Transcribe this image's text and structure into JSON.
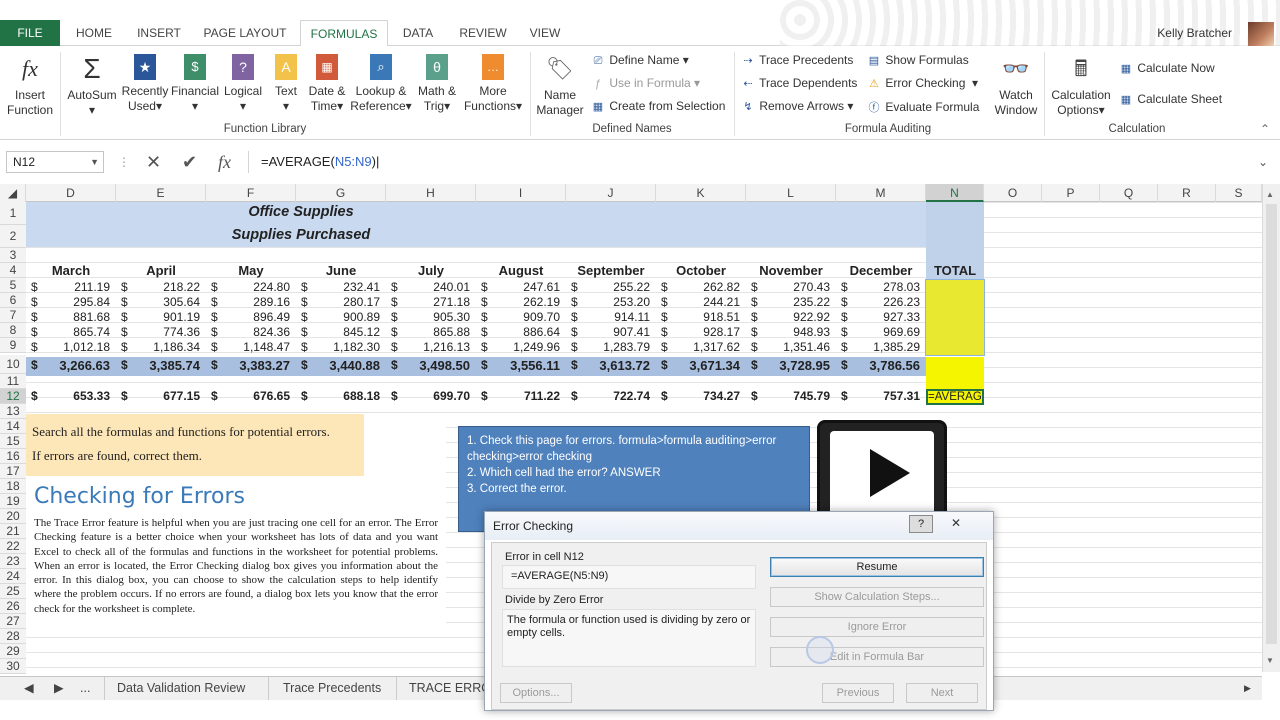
{
  "tabs": {
    "file": "FILE",
    "home": "HOME",
    "insert": "INSERT",
    "page_layout": "PAGE LAYOUT",
    "formulas": "FORMULAS",
    "data": "DATA",
    "review": "REVIEW",
    "view": "VIEW"
  },
  "user": "Kelly Bratcher",
  "ribbon": {
    "insert_function": [
      "Insert",
      "Function"
    ],
    "autosum": "AutoSum",
    "recently": [
      "Recently",
      "Used"
    ],
    "financial": "Financial",
    "logical": "Logical",
    "text": "Text",
    "date_time": [
      "Date &",
      "Time"
    ],
    "lookup": [
      "Lookup &",
      "Reference"
    ],
    "math": [
      "Math &",
      "Trig"
    ],
    "more": [
      "More",
      "Functions"
    ],
    "function_library": "Function Library",
    "name_manager": [
      "Name",
      "Manager"
    ],
    "define_name": "Define Name",
    "use_in_formula": "Use in Formula",
    "create_from_selection": "Create from Selection",
    "defined_names": "Defined Names",
    "trace_precedents": "Trace Precedents",
    "trace_dependents": "Trace Dependents",
    "remove_arrows": "Remove Arrows",
    "show_formulas": "Show Formulas",
    "error_checking": "Error Checking",
    "evaluate_formula": "Evaluate Formula",
    "formula_auditing": "Formula Auditing",
    "watch_window": [
      "Watch",
      "Window"
    ],
    "calc_options": [
      "Calculation",
      "Options"
    ],
    "calc_now": "Calculate Now",
    "calc_sheet": "Calculate Sheet",
    "calculation": "Calculation"
  },
  "formula_bar": {
    "name_box": "N12",
    "formula_prefix": "=AVERAGE(",
    "formula_ref": "N5:N9",
    "formula_suffix": ")"
  },
  "columns": [
    "D",
    "E",
    "F",
    "G",
    "H",
    "I",
    "J",
    "K",
    "L",
    "M",
    "N",
    "O",
    "P",
    "Q",
    "R",
    "S"
  ],
  "rows": [
    "1",
    "2",
    "3",
    "4",
    "5",
    "6",
    "7",
    "8",
    "9",
    "10",
    "11",
    "12",
    "13",
    "14",
    "15",
    "16",
    "17",
    "18",
    "19",
    "20",
    "21",
    "22",
    "23",
    "24",
    "25",
    "26",
    "27",
    "28",
    "29",
    "30"
  ],
  "sheet": {
    "title1": "Office Supplies",
    "title2": "Supplies Purchased",
    "months": [
      "March",
      "April",
      "May",
      "June",
      "July",
      "August",
      "September",
      "October",
      "November",
      "December"
    ],
    "total_label": "TOTAL",
    "currency": "$",
    "data": [
      [
        "211.19",
        "218.22",
        "224.80",
        "232.41",
        "240.01",
        "247.61",
        "255.22",
        "262.82",
        "270.43",
        "278.03"
      ],
      [
        "295.84",
        "305.64",
        "289.16",
        "280.17",
        "271.18",
        "262.19",
        "253.20",
        "244.21",
        "235.22",
        "226.23"
      ],
      [
        "881.68",
        "901.19",
        "896.49",
        "900.89",
        "905.30",
        "909.70",
        "914.11",
        "918.51",
        "922.92",
        "927.33"
      ],
      [
        "865.74",
        "774.36",
        "824.36",
        "845.12",
        "865.88",
        "886.64",
        "907.41",
        "928.17",
        "948.93",
        "969.69"
      ],
      [
        "1,012.18",
        "1,186.34",
        "1,148.47",
        "1,182.30",
        "1,216.13",
        "1,249.96",
        "1,283.79",
        "1,317.62",
        "1,351.46",
        "1,385.29"
      ]
    ],
    "totals": [
      "3,266.63",
      "3,385.74",
      "3,383.27",
      "3,440.88",
      "3,498.50",
      "3,556.11",
      "3,613.72",
      "3,671.34",
      "3,728.95",
      "3,786.56"
    ],
    "averages": [
      "653.33",
      "677.15",
      "676.65",
      "688.18",
      "699.70",
      "711.22",
      "722.74",
      "734.27",
      "745.79",
      "757.31"
    ],
    "n12": "=AVERAG"
  },
  "book": {
    "note1": "Search all the formulas and functions for potential errors.",
    "note2": "If errors are found, correct them.",
    "title": "Checking for Errors",
    "body": "The Trace Error feature is helpful when you are just tracing one cell for an error. The Error Checking feature is a better choice when your worksheet has lots of data and you want Excel to check all of the formulas and functions in the worksheet for potential problems. When an error is located, the Error Checking dialog box gives you information about the error. In this dialog box, you can choose to show the calculation steps to help identify where the problem occurs. If no errors are found, a dialog box lets you know that the error check for the worksheet is complete."
  },
  "instructions": [
    "1. Check this page for errors. formula>formula auditing>error checking>error checking",
    "2. Which cell had the error? ANSWER",
    "3. Correct the error."
  ],
  "dialog": {
    "title": "Error Checking",
    "help": "?",
    "close": "✕",
    "error_in": "Error in cell N12",
    "formula": "=AVERAGE(N5:N9)",
    "error_type": "Divide by Zero Error",
    "description": "The formula or function used is dividing by zero or empty cells.",
    "resume": "Resume",
    "show_steps": "Show Calculation Steps...",
    "ignore": "Ignore Error",
    "edit": "Edit in Formula Bar",
    "options": "Options...",
    "previous": "Previous",
    "next": "Next"
  },
  "sheet_tabs": {
    "ellipsis": "...",
    "tab1": "Data Validation Review",
    "tab2": "Trace Precedents",
    "tab3": "TRACE ERRO"
  },
  "colors": {
    "excel_green": "#217346",
    "header_band": "#c9d9ef",
    "total_band": "#a8bfe0",
    "highlight": "#e8e830",
    "instr_blue": "#4f81bd"
  }
}
